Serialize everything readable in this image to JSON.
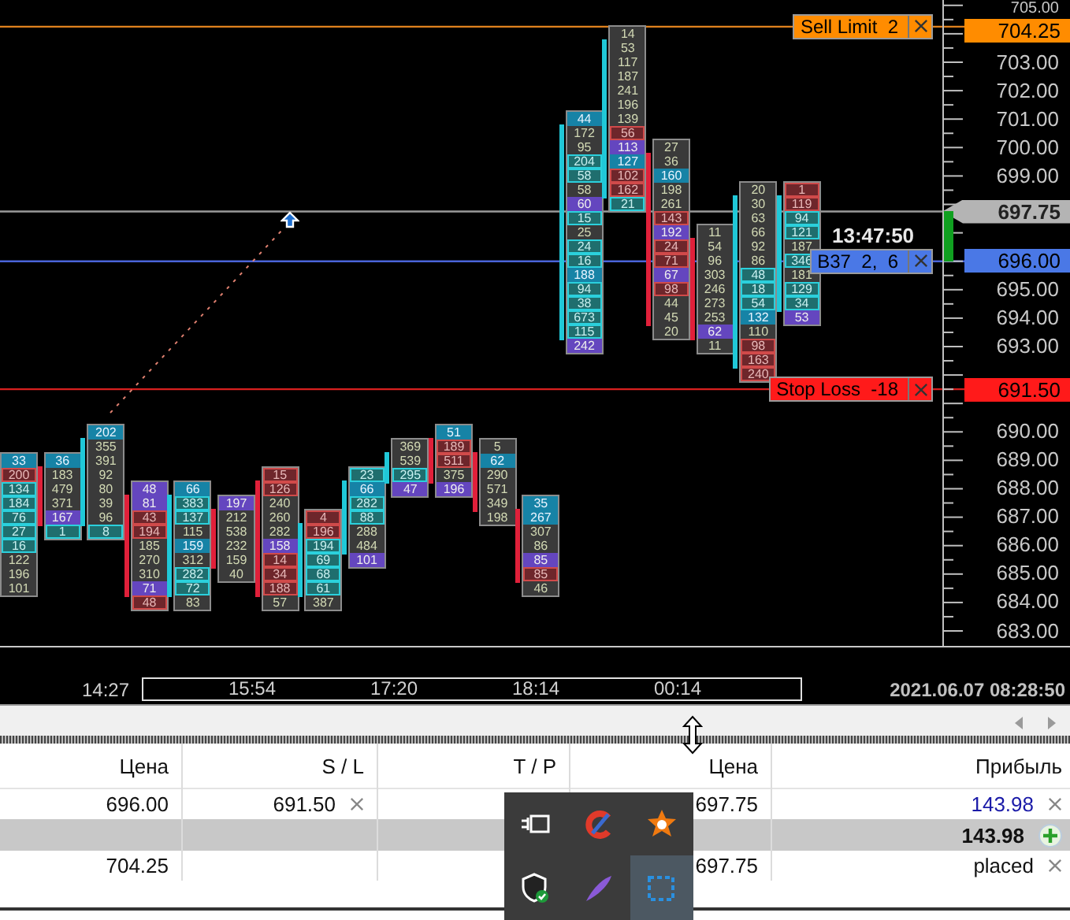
{
  "chart": {
    "price_axis": [
      "705.00",
      "703.00",
      "702.00",
      "701.00",
      "700.00",
      "699.00",
      "695.00",
      "694.00",
      "693.00",
      "690.00",
      "689.00",
      "688.00",
      "687.00",
      "686.00",
      "685.00",
      "684.00",
      "683.00"
    ],
    "last_price": {
      "price": "697.75"
    },
    "timer": "13:47:50",
    "orders": [
      {
        "kind": "sell_limit",
        "label": "Sell Limit  2",
        "price": "704.25"
      },
      {
        "kind": "buy",
        "label": "B37  2,  6",
        "price": "696.00"
      },
      {
        "kind": "stop_loss",
        "label": "Stop Loss  -18",
        "price": "691.50"
      }
    ],
    "candles": [
      {
        "kind": "plain",
        "cells": [
          {
            "text": "33",
            "kind": "blue"
          },
          {
            "text": "200",
            "kind": "red"
          },
          {
            "text": "134",
            "kind": "teal"
          },
          {
            "text": "184",
            "kind": "teal"
          },
          {
            "text": "76",
            "kind": "teal"
          },
          {
            "text": "27",
            "kind": "teal"
          },
          {
            "text": "16",
            "kind": "teal"
          },
          {
            "text": "122",
            "kind": "plain"
          },
          {
            "text": "196",
            "kind": "plain"
          },
          {
            "text": "101",
            "kind": "plain"
          }
        ]
      },
      {
        "kind": "sell",
        "cells": [
          {
            "text": "36",
            "kind": "blue"
          },
          {
            "text": "183",
            "kind": "plain"
          },
          {
            "text": "479",
            "kind": "plain"
          },
          {
            "text": "371",
            "kind": "plain"
          },
          {
            "text": "167",
            "kind": "purple"
          },
          {
            "text": "1",
            "kind": "teal"
          }
        ]
      },
      {
        "kind": "buy",
        "cells": [
          {
            "text": "202",
            "kind": "blue"
          },
          {
            "text": "355",
            "kind": "plain"
          },
          {
            "text": "391",
            "kind": "plain"
          },
          {
            "text": "92",
            "kind": "plain"
          },
          {
            "text": "80",
            "kind": "plain"
          },
          {
            "text": "39",
            "kind": "plain"
          },
          {
            "text": "96",
            "kind": "plain"
          },
          {
            "text": "8",
            "kind": "teal"
          }
        ]
      },
      {
        "kind": "sell",
        "cells": [
          {
            "text": "48",
            "kind": "purple"
          },
          {
            "text": "81",
            "kind": "purple"
          },
          {
            "text": "43",
            "kind": "red"
          },
          {
            "text": "194",
            "kind": "red"
          },
          {
            "text": "185",
            "kind": "plain"
          },
          {
            "text": "270",
            "kind": "plain"
          },
          {
            "text": "310",
            "kind": "plain"
          },
          {
            "text": "71",
            "kind": "purple"
          },
          {
            "text": "48",
            "kind": "red"
          }
        ]
      },
      {
        "kind": "buy",
        "cells": [
          {
            "text": "66",
            "kind": "blue"
          },
          {
            "text": "383",
            "kind": "teal"
          },
          {
            "text": "137",
            "kind": "teal"
          },
          {
            "text": "115",
            "kind": "plain"
          },
          {
            "text": "159",
            "kind": "blue"
          },
          {
            "text": "312",
            "kind": "plain"
          },
          {
            "text": "282",
            "kind": "teal"
          },
          {
            "text": "72",
            "kind": "teal"
          },
          {
            "text": "83",
            "kind": "plain"
          }
        ]
      },
      {
        "kind": "sell",
        "cells": [
          {
            "text": "197",
            "kind": "purple"
          },
          {
            "text": "212",
            "kind": "plain"
          },
          {
            "text": "538",
            "kind": "plain"
          },
          {
            "text": "232",
            "kind": "plain"
          },
          {
            "text": "159",
            "kind": "plain"
          },
          {
            "text": "40",
            "kind": "plain"
          }
        ]
      },
      {
        "kind": "sell",
        "cells": [
          {
            "text": "15",
            "kind": "red"
          },
          {
            "text": "126",
            "kind": "red"
          },
          {
            "text": "240",
            "kind": "plain"
          },
          {
            "text": "260",
            "kind": "plain"
          },
          {
            "text": "282",
            "kind": "plain"
          },
          {
            "text": "158",
            "kind": "purple"
          },
          {
            "text": "14",
            "kind": "red"
          },
          {
            "text": "34",
            "kind": "red"
          },
          {
            "text": "188",
            "kind": "red"
          },
          {
            "text": "57",
            "kind": "plain"
          }
        ]
      },
      {
        "kind": "buy",
        "cells": [
          {
            "text": "4",
            "kind": "red"
          },
          {
            "text": "196",
            "kind": "red"
          },
          {
            "text": "194",
            "kind": "teal"
          },
          {
            "text": "69",
            "kind": "teal"
          },
          {
            "text": "68",
            "kind": "teal"
          },
          {
            "text": "61",
            "kind": "teal"
          },
          {
            "text": "387",
            "kind": "plain"
          }
        ]
      },
      {
        "kind": "buy",
        "cells": [
          {
            "text": "23",
            "kind": "teal"
          },
          {
            "text": "66",
            "kind": "blue"
          },
          {
            "text": "282",
            "kind": "teal"
          },
          {
            "text": "88",
            "kind": "teal"
          },
          {
            "text": "288",
            "kind": "plain"
          },
          {
            "text": "484",
            "kind": "plain"
          },
          {
            "text": "101",
            "kind": "purple"
          }
        ]
      },
      {
        "kind": "buy",
        "cells": [
          {
            "text": "369",
            "kind": "plain"
          },
          {
            "text": "539",
            "kind": "plain"
          },
          {
            "text": "295",
            "kind": "teal"
          },
          {
            "text": "47",
            "kind": "purple"
          }
        ]
      },
      {
        "kind": "sell",
        "cells": [
          {
            "text": "51",
            "kind": "blue"
          },
          {
            "text": "189",
            "kind": "red"
          },
          {
            "text": "511",
            "kind": "red"
          },
          {
            "text": "375",
            "kind": "plain"
          },
          {
            "text": "196",
            "kind": "purple"
          }
        ]
      },
      {
        "kind": "sell",
        "cells": [
          {
            "text": "5",
            "kind": "plain"
          },
          {
            "text": "62",
            "kind": "blue"
          },
          {
            "text": "290",
            "kind": "plain"
          },
          {
            "text": "571",
            "kind": "plain"
          },
          {
            "text": "349",
            "kind": "plain"
          },
          {
            "text": "198",
            "kind": "plain"
          }
        ]
      },
      {
        "kind": "sell",
        "cells": [
          {
            "text": "35",
            "kind": "blue"
          },
          {
            "text": "267",
            "kind": "blue"
          },
          {
            "text": "307",
            "kind": "plain"
          },
          {
            "text": "86",
            "kind": "plain"
          },
          {
            "text": "85",
            "kind": "purple"
          },
          {
            "text": "85",
            "kind": "red"
          },
          {
            "text": "46",
            "kind": "plain"
          }
        ]
      },
      {
        "kind": "buy",
        "cells": [
          {
            "text": "44",
            "kind": "blue"
          },
          {
            "text": "172",
            "kind": "plain"
          },
          {
            "text": "95",
            "kind": "plain"
          },
          {
            "text": "204",
            "kind": "teal"
          },
          {
            "text": "58",
            "kind": "teal"
          },
          {
            "text": "58",
            "kind": "plain"
          },
          {
            "text": "60",
            "kind": "purple"
          },
          {
            "text": "15",
            "kind": "teal"
          },
          {
            "text": "25",
            "kind": "plain"
          },
          {
            "text": "24",
            "kind": "teal"
          },
          {
            "text": "16",
            "kind": "teal"
          },
          {
            "text": "188",
            "kind": "blue"
          },
          {
            "text": "94",
            "kind": "teal"
          },
          {
            "text": "38",
            "kind": "teal"
          },
          {
            "text": "673",
            "kind": "teal"
          },
          {
            "text": "115",
            "kind": "teal"
          },
          {
            "text": "242",
            "kind": "purple"
          }
        ]
      },
      {
        "kind": "buy",
        "cells": [
          {
            "text": "14",
            "kind": "plain"
          },
          {
            "text": "53",
            "kind": "plain"
          },
          {
            "text": "117",
            "kind": "plain"
          },
          {
            "text": "187",
            "kind": "plain"
          },
          {
            "text": "241",
            "kind": "plain"
          },
          {
            "text": "196",
            "kind": "plain"
          },
          {
            "text": "139",
            "kind": "plain"
          },
          {
            "text": "56",
            "kind": "red"
          },
          {
            "text": "113",
            "kind": "purple"
          },
          {
            "text": "127",
            "kind": "blue"
          },
          {
            "text": "102",
            "kind": "red"
          },
          {
            "text": "162",
            "kind": "red"
          },
          {
            "text": "21",
            "kind": "teal"
          }
        ]
      },
      {
        "kind": "sell",
        "cells": [
          {
            "text": "27",
            "kind": "plain"
          },
          {
            "text": "36",
            "kind": "plain"
          },
          {
            "text": "160",
            "kind": "blue"
          },
          {
            "text": "198",
            "kind": "plain"
          },
          {
            "text": "261",
            "kind": "plain"
          },
          {
            "text": "143",
            "kind": "red"
          },
          {
            "text": "192",
            "kind": "purple"
          },
          {
            "text": "24",
            "kind": "red"
          },
          {
            "text": "71",
            "kind": "red"
          },
          {
            "text": "67",
            "kind": "purple"
          },
          {
            "text": "98",
            "kind": "red"
          },
          {
            "text": "44",
            "kind": "plain"
          },
          {
            "text": "45",
            "kind": "plain"
          },
          {
            "text": "20",
            "kind": "plain"
          }
        ]
      },
      {
        "kind": "sell",
        "cells": [
          {
            "text": "11",
            "kind": "plain"
          },
          {
            "text": "54",
            "kind": "plain"
          },
          {
            "text": "96",
            "kind": "plain"
          },
          {
            "text": "303",
            "kind": "plain"
          },
          {
            "text": "246",
            "kind": "plain"
          },
          {
            "text": "273",
            "kind": "plain"
          },
          {
            "text": "253",
            "kind": "plain"
          },
          {
            "text": "62",
            "kind": "purple"
          },
          {
            "text": "11",
            "kind": "plain"
          }
        ]
      },
      {
        "kind": "buy",
        "cells": [
          {
            "text": "20",
            "kind": "plain"
          },
          {
            "text": "30",
            "kind": "plain"
          },
          {
            "text": "63",
            "kind": "plain"
          },
          {
            "text": "66",
            "kind": "plain"
          },
          {
            "text": "92",
            "kind": "plain"
          },
          {
            "text": "86",
            "kind": "plain"
          },
          {
            "text": "48",
            "kind": "teal"
          },
          {
            "text": "18",
            "kind": "teal"
          },
          {
            "text": "54",
            "kind": "teal"
          },
          {
            "text": "132",
            "kind": "blue"
          },
          {
            "text": "110",
            "kind": "plain"
          },
          {
            "text": "98",
            "kind": "red"
          },
          {
            "text": "163",
            "kind": "red"
          },
          {
            "text": "240",
            "kind": "red"
          }
        ]
      },
      {
        "kind": "buy",
        "cells": [
          {
            "text": "1",
            "kind": "red"
          },
          {
            "text": "119",
            "kind": "red"
          },
          {
            "text": "94",
            "kind": "teal"
          },
          {
            "text": "121",
            "kind": "teal"
          },
          {
            "text": "187",
            "kind": "plain"
          },
          {
            "text": "346",
            "kind": "teal"
          },
          {
            "text": "181",
            "kind": "plain"
          },
          {
            "text": "129",
            "kind": "teal"
          },
          {
            "text": "34",
            "kind": "teal"
          },
          {
            "text": "53",
            "kind": "purple"
          }
        ]
      }
    ]
  },
  "time_axis": {
    "labels": [
      "14:27",
      "15:54",
      "17:20",
      "18:14",
      "00:14"
    ],
    "datetime": "2021.06.07 08:28:50"
  },
  "table": {
    "columns": [
      "Цена",
      "S / L",
      "T / P",
      "Цена",
      "Прибыль"
    ],
    "rows": [
      {
        "kind": "position",
        "open_price": "696.00",
        "sl": "691.50",
        "price": "697.75",
        "profit": "143.98"
      },
      {
        "kind": "total",
        "profit": "143.98"
      },
      {
        "kind": "order",
        "open_price": "704.25",
        "price": "697.75",
        "profit": "placed"
      }
    ]
  }
}
